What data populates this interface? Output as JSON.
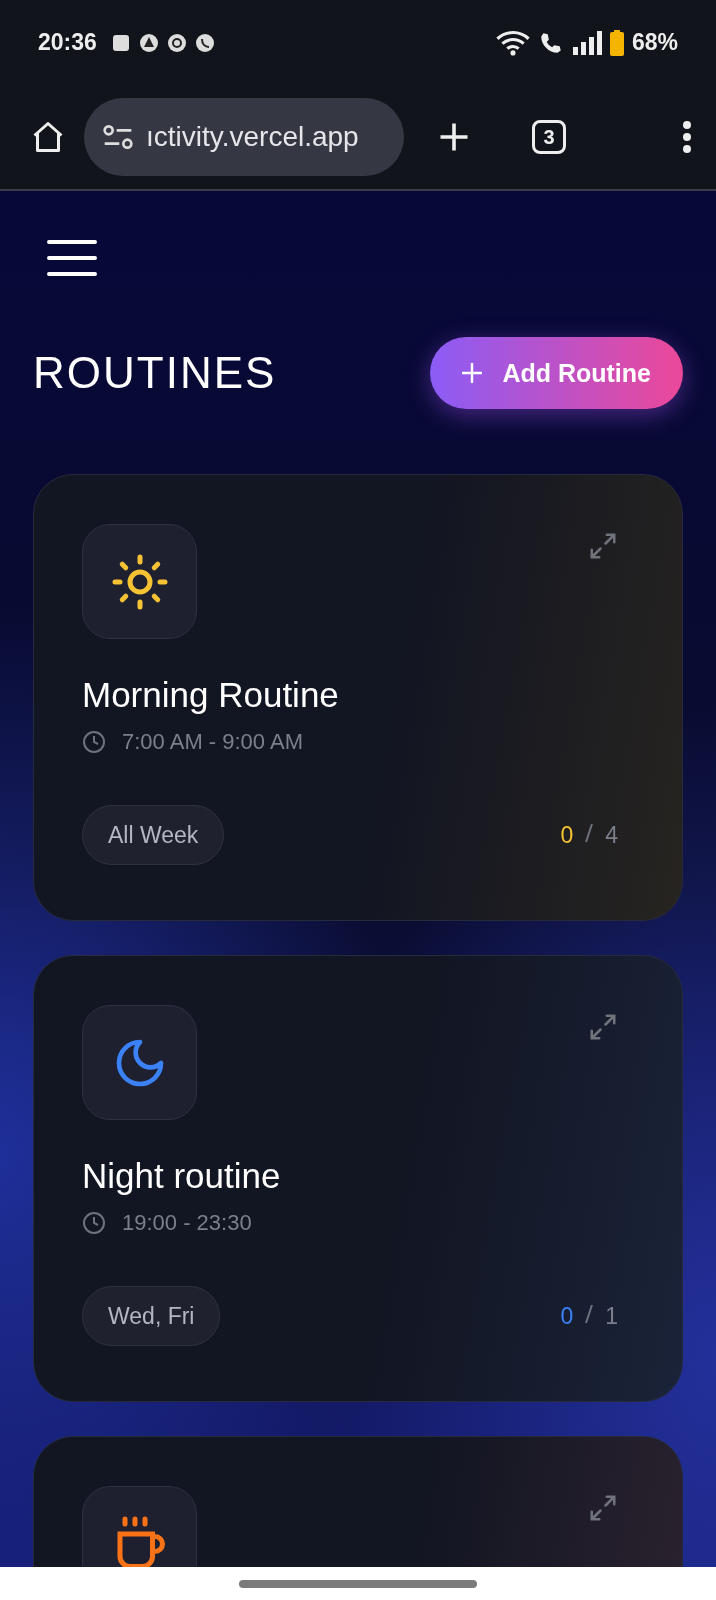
{
  "status_bar": {
    "time": "20:36",
    "battery": "68%"
  },
  "browser": {
    "url": "ıctivity.vercel.app",
    "tab_count": "3"
  },
  "page": {
    "title": "ROUTINES",
    "add_button": "Add Routine"
  },
  "routines": [
    {
      "kind": "sun",
      "color": "#f5c233",
      "name": "Morning Routine",
      "time": "7:00 AM - 9:00 AM",
      "days": "All Week",
      "done": "0",
      "total": "4"
    },
    {
      "kind": "moon",
      "color": "#3b82f6",
      "name": "Night routine",
      "time": "19:00 - 23:30",
      "days": "Wed, Fri",
      "done": "0",
      "total": "1"
    },
    {
      "kind": "cup",
      "color": "#f97316"
    }
  ]
}
